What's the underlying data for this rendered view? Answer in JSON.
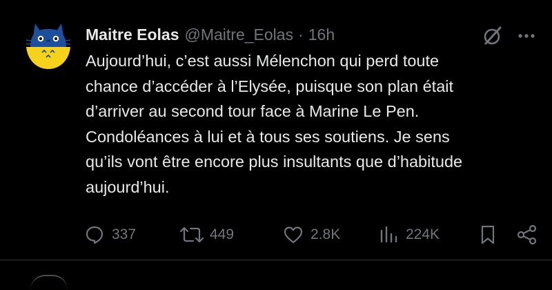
{
  "tweet": {
    "author_name": "Maitre Eolas",
    "handle": "@Maitre_Eolas",
    "separator": "·",
    "time": "16h",
    "text_lines": [
      "Aujourd’hui, c’est aussi Mélenchon qui perd toute",
      "chance d’accéder à l’Elysée, puisque son plan était",
      "d’arriver au second tour face à Marine Le Pen.",
      "Condoléances à lui et à tous ses soutiens. Je sens",
      "qu’ils vont être encore plus insultants que d’habitude",
      "aujourd’hui."
    ],
    "actions": {
      "replies": "337",
      "reposts": "449",
      "likes": "2.8K",
      "views": "224K"
    },
    "icons": {
      "avatar": "totoro-avatar",
      "grok": "grok-icon",
      "more": "more-icon",
      "reply": "reply-icon",
      "repost": "repost-icon",
      "like": "heart-icon",
      "views": "views-icon",
      "bookmark": "bookmark-icon",
      "share": "share-icon"
    }
  },
  "colors": {
    "background": "#000000",
    "text_primary": "#e7e9ea",
    "text_secondary": "#71767b",
    "divider": "#2f3336",
    "avatar_blue": "#1d4f9c",
    "avatar_yellow": "#f6d31a"
  }
}
